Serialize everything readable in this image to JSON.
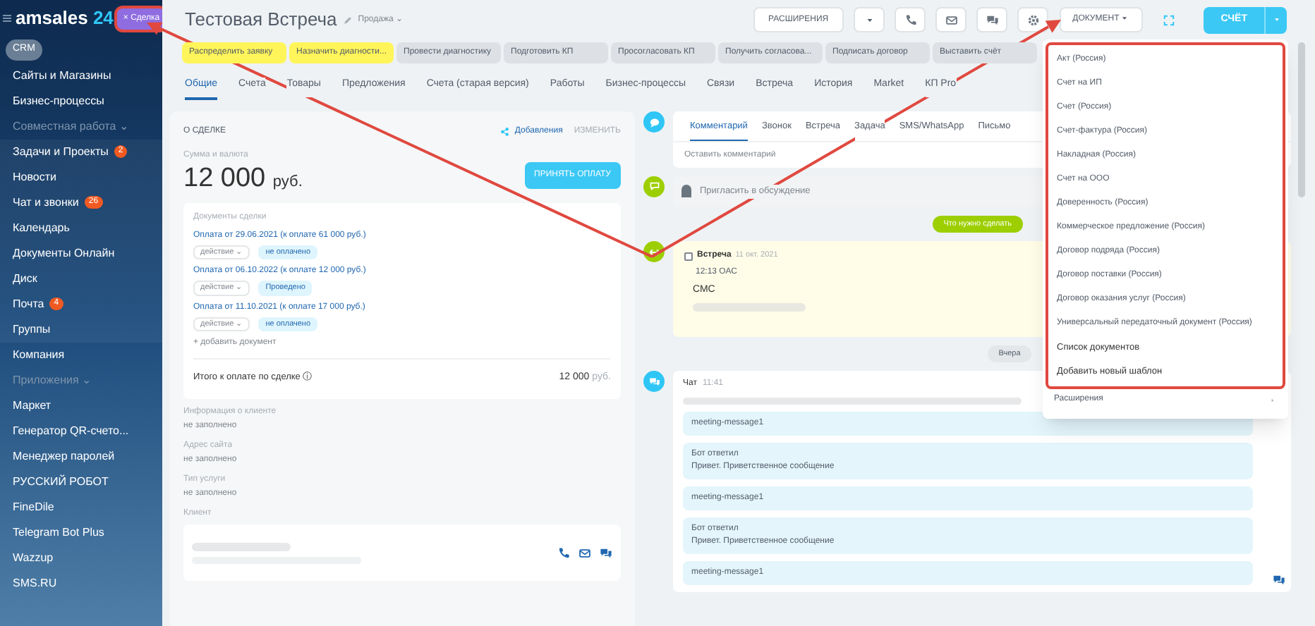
{
  "sidebar": {
    "logo": "amsales",
    "logo_suffix": "24",
    "entity_badge": "× Сделка",
    "items": [
      {
        "label": "CRM",
        "kind": "pill"
      },
      {
        "label": "Сайты и Магазины",
        "kind": "item"
      },
      {
        "label": "Бизнес-процессы",
        "kind": "item"
      },
      {
        "label": "Совместная работа ⌄",
        "kind": "section"
      },
      {
        "label": "Задачи и Проекты",
        "kind": "group",
        "badge": "2"
      },
      {
        "label": "Новости",
        "kind": "group"
      },
      {
        "label": "Чат и звонки",
        "kind": "group",
        "badge": "26"
      },
      {
        "label": "Календарь",
        "kind": "group"
      },
      {
        "label": "Документы Онлайн",
        "kind": "group"
      },
      {
        "label": "Диск",
        "kind": "group"
      },
      {
        "label": "Почта",
        "kind": "group",
        "badge": "4"
      },
      {
        "label": "Группы",
        "kind": "group"
      },
      {
        "label": "Компания",
        "kind": "item"
      },
      {
        "label": "Приложения ⌄",
        "kind": "section"
      },
      {
        "label": "Маркет",
        "kind": "item"
      },
      {
        "label": "Генератор QR-счето...",
        "kind": "item"
      },
      {
        "label": "Менеджер паролей",
        "kind": "item"
      },
      {
        "label": "РУССКИЙ РОБОТ",
        "kind": "item"
      },
      {
        "label": "FineDile",
        "kind": "item"
      },
      {
        "label": "Telegram Bot Plus",
        "kind": "item"
      },
      {
        "label": "Wazzup",
        "kind": "item"
      },
      {
        "label": "SMS.RU",
        "kind": "item"
      }
    ]
  },
  "header": {
    "title": "Тестовая Встреча",
    "pipeline": "Продажа ⌄",
    "extensions_button": "РАСШИРЕНИЯ",
    "icon_buttons": [
      {
        "kind": "caret"
      },
      {
        "kind": "phone"
      },
      {
        "kind": "mail"
      },
      {
        "kind": "chat"
      },
      {
        "kind": "gear"
      }
    ],
    "document_button": "ДОКУМЕНТ",
    "invoice_button": "СЧЁТ"
  },
  "stages": [
    {
      "label": "Распределить заявку",
      "passed": true
    },
    {
      "label": "Назначить диагности...",
      "passed": true
    },
    {
      "label": "Провести диагностику",
      "passed": false
    },
    {
      "label": "Подготовить КП",
      "passed": false
    },
    {
      "label": "Просогласовать КП",
      "passed": false
    },
    {
      "label": "Получить согласова...",
      "passed": false
    },
    {
      "label": "Подписать договор",
      "passed": false
    },
    {
      "label": "Выставить счёт",
      "passed": false
    }
  ],
  "tabs": [
    {
      "label": "Общие",
      "selected": true
    },
    {
      "label": "Счета",
      "selected": false
    },
    {
      "label": "Товары",
      "selected": false
    },
    {
      "label": "Предложения",
      "selected": false
    },
    {
      "label": "Счета (старая версия)",
      "selected": false
    },
    {
      "label": "Работы",
      "selected": false
    },
    {
      "label": "Бизнес-процессы",
      "selected": false
    },
    {
      "label": "Связи",
      "selected": false
    },
    {
      "label": "Встреча",
      "selected": false
    },
    {
      "label": "История",
      "selected": false
    },
    {
      "label": "Market",
      "selected": false
    },
    {
      "label": "КП Pro",
      "selected": false
    }
  ],
  "deal_card": {
    "title": "О СДЕЛКЕ",
    "link": "Добавления",
    "edit": "ИЗМЕНИТЬ",
    "amount_label": "Сумма и валюта",
    "amount": "12 000",
    "currency": "руб.",
    "accept_button": "ПРИНЯТЬ ОПЛАТУ",
    "documents_title": "Документы сделки",
    "documents": [
      {
        "title": "Оплата от 29.06.2021 (к оплате 61 000 руб.)",
        "action": "действие ⌄",
        "status": "не оплачено"
      },
      {
        "title": "Оплата от 06.10.2022 (к оплате 12 000 руб.)",
        "action": "действие ⌄",
        "status": "Проведено"
      },
      {
        "title": "Оплата от 11.10.2021 (к оплате 17 000 руб.)",
        "action": "действие ⌄",
        "status": "не оплачено"
      }
    ],
    "add_document": "+ добавить документ",
    "total_label": "Итого к оплате по сделке ⓘ",
    "total": "12 000",
    "total_currency": "руб.",
    "fields": [
      {
        "label": "Информация о клиенте",
        "value": "не заполнено"
      },
      {
        "label": "Адрес сайта",
        "value": "не заполнено"
      },
      {
        "label": "Тип услуги",
        "value": "не заполнено"
      }
    ],
    "client_label": "Клиент"
  },
  "timeline": {
    "editor_tabs": [
      {
        "label": "Комментарий",
        "selected": true
      },
      {
        "label": "Звонок",
        "selected": false
      },
      {
        "label": "Встреча",
        "selected": false
      },
      {
        "label": "Задача",
        "selected": false
      },
      {
        "label": "SMS/WhatsApp",
        "selected": false
      },
      {
        "label": "Письмо",
        "selected": false
      }
    ],
    "comment_placeholder": "Оставить комментарий",
    "invite": "Пригласить в обсуждение",
    "todo_pill": "Что нужно сделать",
    "meeting": {
      "title": "Встреча",
      "date": "11 окт. 2021",
      "time": "12:13 ОАС",
      "text": "СМС",
      "done": false
    },
    "day_pill": "Вчера",
    "chat": {
      "title": "Чат",
      "time": "11:41",
      "messages": [
        {
          "text": "meeting-message1"
        },
        {
          "text": "Бот ответил",
          "subtext": "Привет. Приветственное сообщение"
        },
        {
          "text": "meeting-message1"
        },
        {
          "text": "Бот ответил",
          "subtext": "Привет. Приветственное сообщение"
        },
        {
          "text": "meeting-message1"
        }
      ]
    }
  },
  "document_menu": {
    "items": [
      {
        "label": "Акт (Россия)",
        "kind": "template"
      },
      {
        "label": "Счет на ИП",
        "kind": "template"
      },
      {
        "label": "Счет (Россия)",
        "kind": "template"
      },
      {
        "label": "Счет-фактура (Россия)",
        "kind": "template"
      },
      {
        "label": "Накладная (Россия)",
        "kind": "template"
      },
      {
        "label": "Счет на ООО",
        "kind": "template"
      },
      {
        "label": "Доверенность (Россия)",
        "kind": "template"
      },
      {
        "label": "Коммерческое предложение (Россия)",
        "kind": "template"
      },
      {
        "label": "Договор подряда (Россия)",
        "kind": "template"
      },
      {
        "label": "Договор поставки (Россия)",
        "kind": "template"
      },
      {
        "label": "Договор оказания услуг (Россия)",
        "kind": "template"
      },
      {
        "label": "Универсальный передаточный документ (Россия)",
        "kind": "template"
      },
      {
        "label": "Список документов",
        "kind": "action"
      },
      {
        "label": "Добавить новый шаблон",
        "kind": "action"
      }
    ],
    "extensions": "Расширения"
  }
}
